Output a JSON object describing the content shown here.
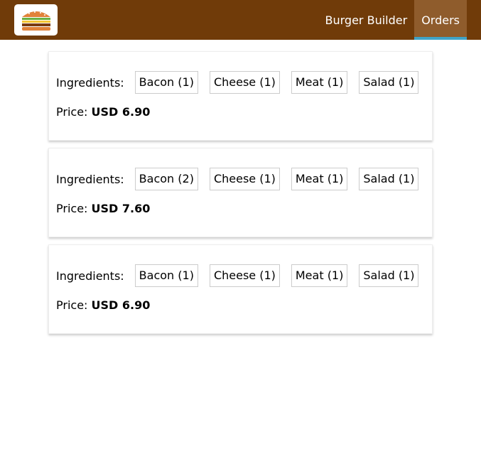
{
  "header": {
    "logo_alt": "burger-logo",
    "nav": [
      {
        "label": "Burger Builder",
        "active": false
      },
      {
        "label": "Orders",
        "active": true
      }
    ]
  },
  "ingredients_label": "Ingredients:",
  "price_label": "Price:",
  "orders": [
    {
      "ingredients": [
        "Bacon (1)",
        "Cheese (1)",
        "Meat (1)",
        "Salad (1)"
      ],
      "price": "USD 6.90"
    },
    {
      "ingredients": [
        "Bacon (2)",
        "Cheese (1)",
        "Meat (1)",
        "Salad (1)"
      ],
      "price": "USD 7.60"
    },
    {
      "ingredients": [
        "Bacon (1)",
        "Cheese (1)",
        "Meat (1)",
        "Salad (1)"
      ],
      "price": "USD 6.90"
    }
  ],
  "colors": {
    "toolbar": "#703b09",
    "active_nav": "#8f5c2c",
    "active_underline": "#40a4c8"
  }
}
